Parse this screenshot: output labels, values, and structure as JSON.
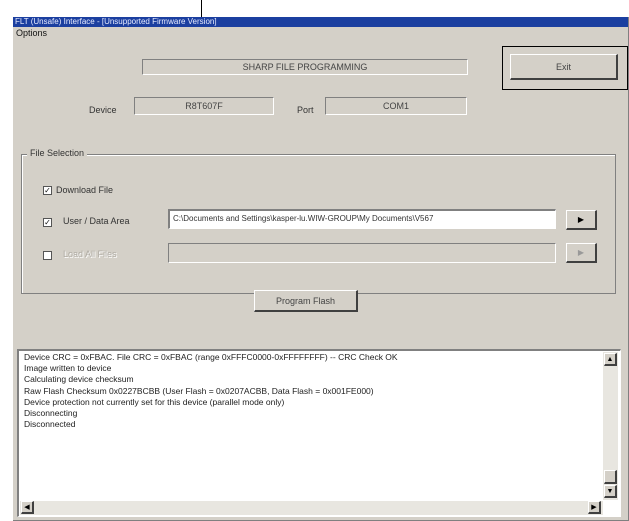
{
  "window": {
    "title": "FLT (Unsafe) Interface - [Unsupported Firmware Version]",
    "menu": [
      "Options"
    ]
  },
  "status": {
    "banner": "SHARP FILE PROGRAMMING"
  },
  "exit_button": {
    "label": "Exit"
  },
  "device": {
    "label": "Device",
    "value": "R8T607F"
  },
  "port": {
    "label": "Port",
    "value": "COM1"
  },
  "file_selection": {
    "title": "File Selection",
    "download_file": {
      "label": "Download File",
      "checked": true
    },
    "user_data_area": {
      "label": "User / Data Area",
      "checked": true,
      "path": "C:\\Documents and Settings\\kasper-lu.WIW-GROUP\\My Documents\\V567"
    },
    "second_file": {
      "label": "Load All Files",
      "checked": false,
      "path": ""
    },
    "browse_icon": "right-triangle-icon"
  },
  "program_button": {
    "label": "Program Flash"
  },
  "log": {
    "lines": [
      "Device CRC = 0xFBAC. File CRC = 0xFBAC (range 0xFFFC0000-0xFFFFFFFF) -- CRC Check OK",
      "Image written to device",
      "Calculating device checksum",
      "Raw Flash Checksum 0x0227BCBB (User Flash = 0x0207ACBB, Data Flash = 0x001FE000)",
      "Device protection not currently set for this device (parallel mode only)",
      "Disconnecting",
      "Disconnected"
    ]
  },
  "colors": {
    "title_bar": "#1b3fa0",
    "window_bg": "#d4d0c8",
    "log_bg": "#ffffff"
  }
}
